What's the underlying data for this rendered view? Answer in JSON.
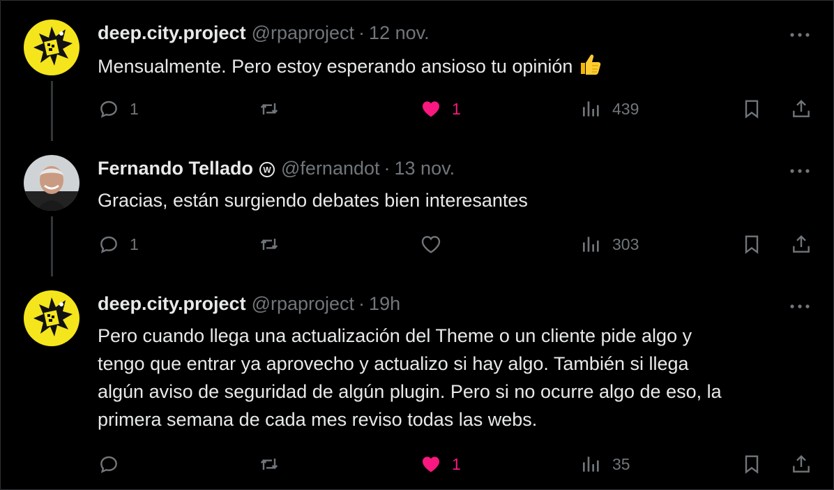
{
  "tweets": [
    {
      "display_name": "deep.city.project",
      "handle": "@rpaproject",
      "separator": "·",
      "date": "12 nov.",
      "text": "Mensualmente. Pero estoy esperando ansioso tu opinión",
      "emoji": "thumbs-up",
      "replies": "1",
      "retweets": "",
      "likes": "1",
      "liked": true,
      "views": "439",
      "avatar": "logo-yellow"
    },
    {
      "display_name": "Fernando Tellado",
      "handle": "@fernandot",
      "separator": "·",
      "date": "13 nov.",
      "text": "Gracias, están surgiendo debates bien interesantes",
      "replies": "1",
      "retweets": "",
      "likes": "",
      "liked": false,
      "views": "303",
      "avatar": "photo"
    },
    {
      "display_name": "deep.city.project",
      "handle": "@rpaproject",
      "separator": "·",
      "date": "19h",
      "text_lines": [
        "Pero cuando llega una actualización del Theme o un cliente pide algo y",
        "tengo que entrar ya aprovecho y actualizo si hay algo. También si llega",
        "algún aviso de seguridad de algún plugin. Pero si no ocurre algo de eso, la",
        "primera semana de cada mes reviso todas las webs."
      ],
      "replies": "",
      "retweets": "",
      "likes": "1",
      "liked": true,
      "views": "35",
      "avatar": "logo-yellow"
    }
  ],
  "colors": {
    "background": "#000000",
    "text": "#e7e9ea",
    "muted": "#71767b",
    "like": "#f91880",
    "avatar_yellow": "#f5e51c"
  }
}
